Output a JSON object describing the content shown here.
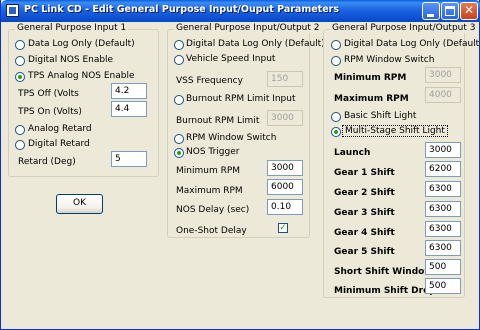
{
  "window": {
    "title": "PC Link CD - Edit General Purpose Input/Ouput Parameters",
    "minimize": "_",
    "maximize": "□",
    "close": "✕"
  },
  "input1": {
    "title": "General Purpose Input 1",
    "radios": [
      {
        "label": "Data Log Only (Default)",
        "checked": false
      },
      {
        "label": "Digital NOS Enable",
        "checked": false
      },
      {
        "label": "TPS Analog NOS Enable",
        "checked": true
      }
    ],
    "tps_off_label": "TPS Off (Volts",
    "tps_off_value": "4.2",
    "tps_on_label": "TPS On (Volts)",
    "tps_on_value": "4.4",
    "radios2": [
      {
        "label": "Analog Retard",
        "checked": false
      },
      {
        "label": "Digital Retard",
        "checked": false
      }
    ],
    "retard_label": "Retard (Deg)",
    "retard_value": "5",
    "ok_label": "OK"
  },
  "io2": {
    "title": "General Purpose Input/Output 2",
    "radio_data_log": "Digital Data Log Only (Default)",
    "radio_vss": "Vehicle Speed Input",
    "vss_label": "VSS Frequency",
    "vss_value": "150",
    "radio_burnout": "Burnout RPM Limit Input",
    "burnout_label": "Burnout RPM Limit",
    "burnout_value": "3000",
    "radio_rpm_window": "RPM Window Switch",
    "radio_nos": "NOS Trigger",
    "min_rpm_label": "Minimum RPM",
    "min_rpm_value": "3000",
    "max_rpm_label": "Maximum RPM",
    "max_rpm_value": "6000",
    "nos_delay_label": "NOS Delay (sec)",
    "nos_delay_value": "0.10",
    "one_shot_label": "One-Shot Delay",
    "one_shot_checked": true
  },
  "io3": {
    "title": "General Purpose Input/Output 3",
    "radio_data_log": "Digital Data Log Only (Default)",
    "radio_rpm_window": "RPM Window Switch",
    "min_rpm_label": "Minimum RPM",
    "min_rpm_value": "3000",
    "max_rpm_label": "Maximum RPM",
    "max_rpm_value": "4000",
    "radio_basic_shift": "Basic Shift Light",
    "radio_multi_shift": "Multi-Stage Shift Light",
    "launch_label": "Launch",
    "launch_value": "3000",
    "gear1_label": "Gear 1 Shift",
    "gear1_value": "6200",
    "gear2_label": "Gear 2 Shift",
    "gear2_value": "6300",
    "gear3_label": "Gear 3 Shift",
    "gear3_value": "6300",
    "gear4_label": "Gear 4 Shift",
    "gear4_value": "6300",
    "gear5_label": "Gear 5 Shift",
    "gear5_value": "6300",
    "short_shift_label": "Short Shift Window",
    "short_shift_value": "500",
    "min_shift_drop_label": "Minimum Shift Drop",
    "min_shift_drop_value": "500"
  }
}
